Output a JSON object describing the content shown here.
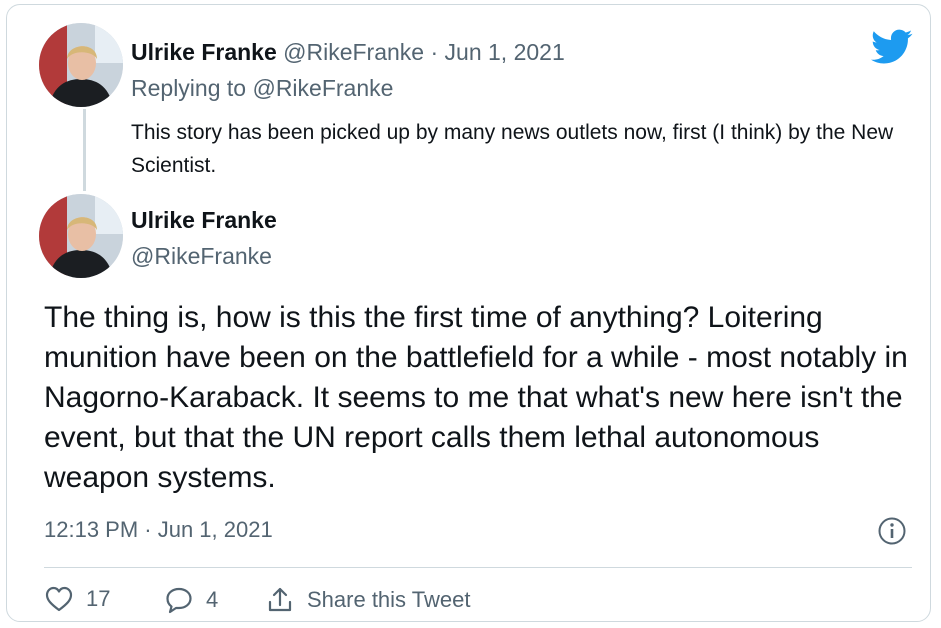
{
  "reply_tweet": {
    "author_name": "Ulrike Franke",
    "author_handle": "@RikeFranke",
    "separator": "·",
    "date": "Jun 1, 2021",
    "replying_to_prefix": "Replying to",
    "replying_to_handle": "@RikeFranke",
    "text": "This story has been picked up by many news outlets now, first (I think) by the New Scientist."
  },
  "main_tweet": {
    "author_name": "Ulrike Franke",
    "author_handle": "@RikeFranke",
    "text": "The thing is, how is this the first time of anything? Loitering munition have been on the battlefield for a while - most notably in Nagorno-Karaback. It seems to me that what's new here isn't the event, but that the UN report calls them lethal autonomous weapon systems.",
    "timestamp": "12:13 PM · Jun 1, 2021"
  },
  "actions": {
    "like_count": "17",
    "reply_count": "4",
    "share_label": "Share this Tweet"
  },
  "icons": {
    "brand": "twitter-bird-icon",
    "info": "info-icon",
    "like": "heart-icon",
    "reply": "speech-bubble-icon",
    "share": "share-upload-icon"
  },
  "colors": {
    "twitter_blue": "#1d9bf0",
    "muted_text": "#536471",
    "border": "#cfd9de"
  }
}
